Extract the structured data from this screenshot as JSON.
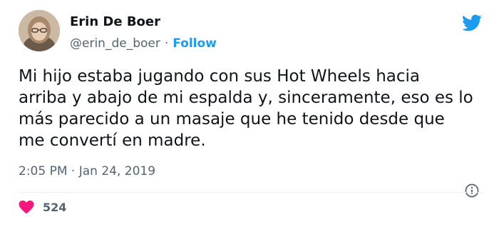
{
  "author": {
    "name": "Erin De Boer",
    "handle": "@erin_de_boer",
    "follow_label": "Follow"
  },
  "tweet": {
    "text": "Mi hijo estaba jugando con sus Hot Wheels hacia\narriba y abajo de mi espalda y, sinceramente, eso es lo\nmás parecido a un masaje que he tenido desde que\nme convertí en madre.",
    "time": "2:05 PM",
    "date": "Jan 24, 2019",
    "separator": "·"
  },
  "engagement": {
    "likes": "524"
  },
  "colors": {
    "accent": "#1d9bf0",
    "heart": "#f91880",
    "secondary_text": "#536471"
  },
  "icons": {
    "brand": "twitter-bird-icon",
    "info": "info-icon",
    "like": "heart-icon"
  }
}
